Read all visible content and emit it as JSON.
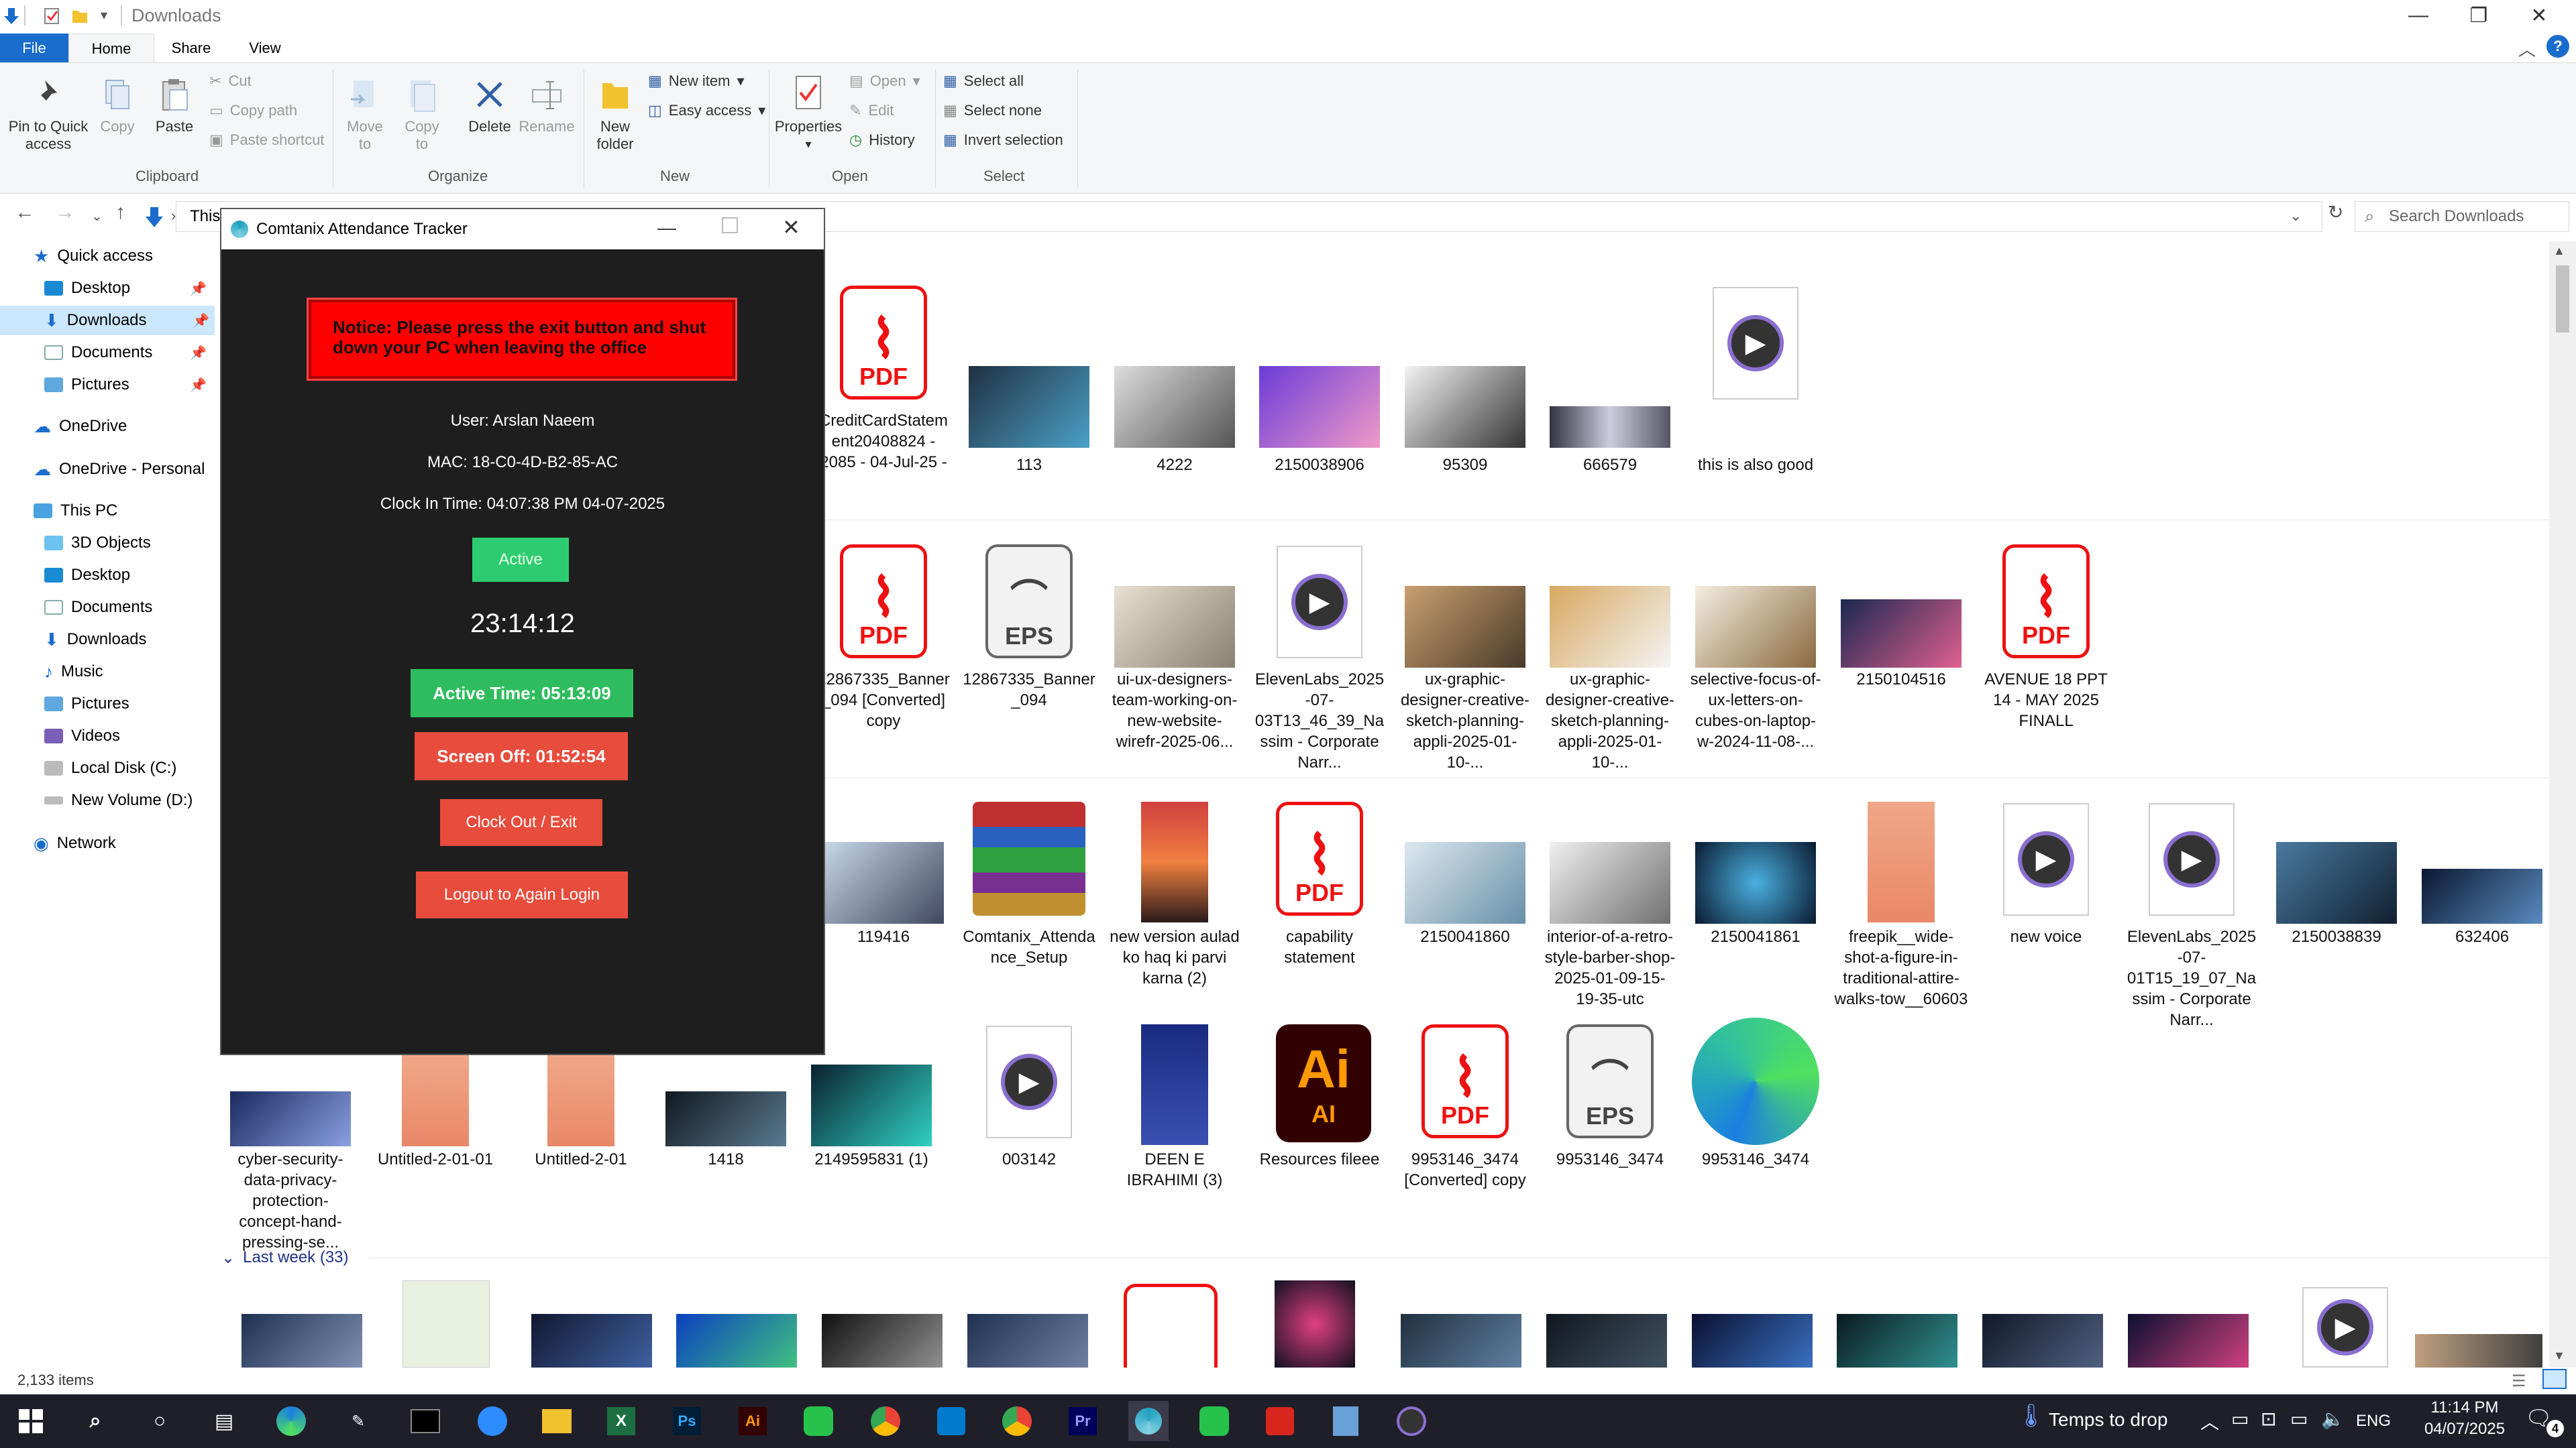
{
  "window": {
    "title": "Downloads",
    "tabs": {
      "file": "File",
      "home": "Home",
      "share": "Share",
      "view": "View"
    }
  },
  "ribbon": {
    "clipboard": {
      "group": "Clipboard",
      "pin": "Pin to Quick access",
      "copy": "Copy",
      "paste": "Paste",
      "cut": "Cut",
      "copy_path": "Copy path",
      "paste_shortcut": "Paste shortcut"
    },
    "organize": {
      "group": "Organize",
      "move_to": "Move to",
      "copy_to": "Copy to",
      "delete": "Delete",
      "rename": "Rename"
    },
    "new": {
      "group": "New",
      "new_folder": "New folder",
      "new_item": "New item",
      "easy_access": "Easy access"
    },
    "open": {
      "group": "Open",
      "properties": "Properties",
      "open": "Open",
      "edit": "Edit",
      "history": "History"
    },
    "select": {
      "group": "Select",
      "select_all": "Select all",
      "select_none": "Select none",
      "invert": "Invert selection"
    }
  },
  "address": {
    "path_visible": "This",
    "search_placeholder": "Search Downloads"
  },
  "nav": {
    "quick_access": "Quick access",
    "qa_items": [
      "Desktop",
      "Downloads",
      "Documents",
      "Pictures"
    ],
    "onedrive": "OneDrive",
    "onedrive_personal": "OneDrive - Personal",
    "this_pc": "This PC",
    "pc_items": [
      "3D Objects",
      "Desktop",
      "Documents",
      "Downloads",
      "Music",
      "Pictures",
      "Videos",
      "Local Disk (C:)",
      "New Volume (D:)"
    ],
    "network": "Network"
  },
  "files": {
    "row1": [
      "CreditCardStatement20408824 - 2085 - 04-Jul-25 -",
      "113",
      "4222",
      "2150038906",
      "95309",
      "666579",
      "this is also good"
    ],
    "row2": [
      "12867335_Banner_094 [Converted] copy",
      "12867335_Banner_094",
      "ui-ux-designers-team-working-on-new-website-wirefr-2025-06...",
      "ElevenLabs_2025-07-03T13_46_39_Nassim - Corporate Narr...",
      "ux-graphic-designer-creative-sketch-planning-appli-2025-01-10-...",
      "ux-graphic-designer-creative-sketch-planning-appli-2025-01-10-...",
      "selective-focus-of-ux-letters-on-cubes-on-laptop-w-2024-11-08-...",
      "2150104516",
      "AVENUE 18 PPT 14 - MAY 2025 FINALL"
    ],
    "row3": [
      "119416",
      "Comtanix_Attendance_Setup",
      "new version aulad ko haq ki parvi karna (2)",
      "capability statement",
      "2150041860",
      "interior-of-a-retro-style-barber-shop-2025-01-09-15-19-35-utc",
      "2150041861",
      "freepik__wide-shot-a-figure-in-traditional-attire-walks-tow__60603",
      "new voice",
      "ElevenLabs_2025-07-01T15_19_07_Nassim - Corporate Narr...",
      "2150038839",
      "632406"
    ],
    "row4": [
      "cyber-security-data-privacy-protection-concept-hand-pressing-se...",
      "Untitled-2-01-01",
      "Untitled-2-01",
      "1418",
      "2149595831 (1)",
      "003142",
      "DEEN E IBRAHIMI (3)",
      "Resources fileee",
      "9953146_3474 [Converted] copy",
      "9953146_3474",
      "9953146_3474"
    ],
    "pdf_label": "PDF",
    "eps_label": "EPS",
    "ai_label": "Ai",
    "ai_sub": "AI",
    "last_week": "Last week (33)"
  },
  "status": {
    "items": "2,133 items"
  },
  "dialog": {
    "title": "Comtanix Attendance Tracker",
    "notice": "Notice: Please press the exit button and shut down your PC when leaving the office",
    "user": "User: Arslan  Naeem",
    "mac": "MAC: 18-C0-4D-B2-85-AC",
    "clock_in": "Clock In Time: 04:07:38 PM 04-07-2025",
    "status_button": "Active",
    "clock": "23:14:12",
    "active_time": "Active Time: 05:13:09",
    "screen_off": "Screen Off: 01:52:54",
    "clock_out": "Clock Out / Exit",
    "logout": "Logout to Again Login"
  },
  "taskbar": {
    "weather": "Temps to drop",
    "lang": "ENG",
    "time": "11:14 PM",
    "date": "04/07/2025",
    "notif_count": "4"
  },
  "colors": {
    "accent": "#1a6dcc",
    "notice_red": "#ff0000",
    "active_green": "#27ae60",
    "danger_red": "#e74c3c",
    "dialog_bg": "#1e1e1e"
  }
}
